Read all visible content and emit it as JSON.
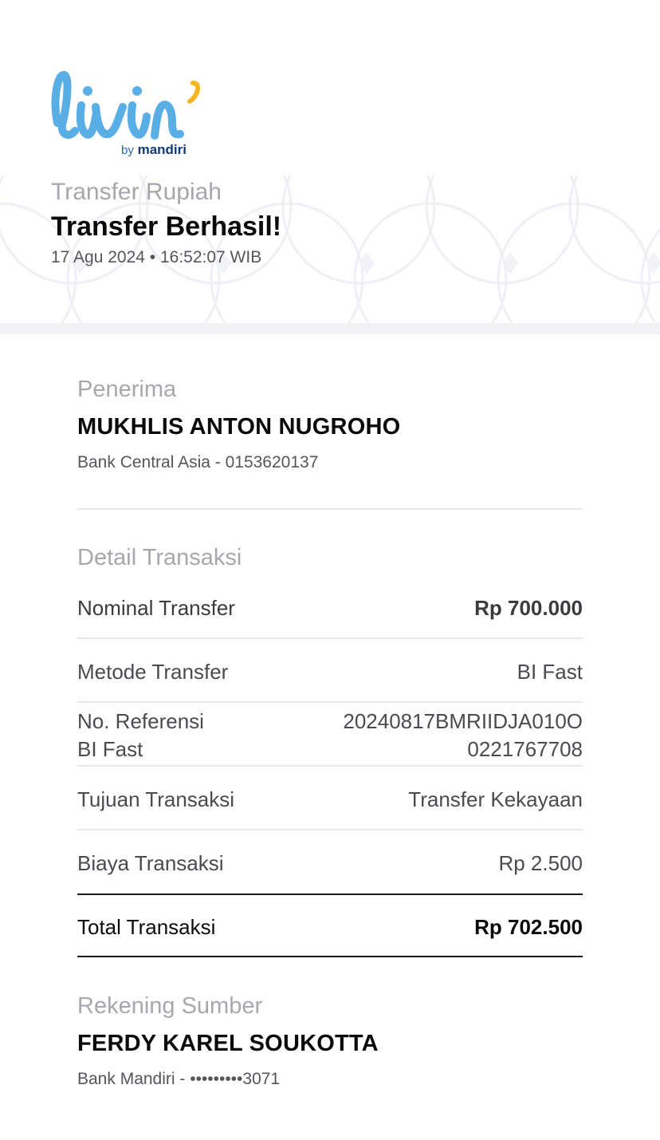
{
  "brand": {
    "logo_text": "livin'",
    "by_text": "by",
    "bank_text": "mandiri",
    "logo_color": "#5aaee6",
    "accent_color": "#f5b51f",
    "bank_color": "#123a73"
  },
  "header": {
    "subtitle": "Transfer Rupiah",
    "title": "Transfer Berhasil!",
    "datetime": "17 Agu 2024 • 16:52:07 WIB"
  },
  "recipient": {
    "label": "Penerima",
    "name": "MUKHLIS ANTON NUGROHO",
    "account": "Bank Central Asia - 0153620137"
  },
  "details": {
    "label": "Detail Transaksi",
    "rows": [
      {
        "label": "Nominal Transfer",
        "value": "Rp 700.000"
      },
      {
        "label": "Metode Transfer",
        "value": "BI Fast"
      },
      {
        "label_line1": "No. Referensi",
        "label_line2": "BI Fast",
        "value_line1": "20240817BMRIIDJA010O",
        "value_line2": "0221767708"
      },
      {
        "label": "Tujuan Transaksi",
        "value": "Transfer Kekayaan"
      },
      {
        "label": "Biaya Transaksi",
        "value": "Rp 2.500"
      }
    ],
    "total": {
      "label": "Total Transaksi",
      "value": "Rp 702.500"
    }
  },
  "source": {
    "label": "Rekening Sumber",
    "name": "FERDY KAREL SOUKOTTA",
    "account": "Bank Mandiri - •••••••••3071"
  }
}
